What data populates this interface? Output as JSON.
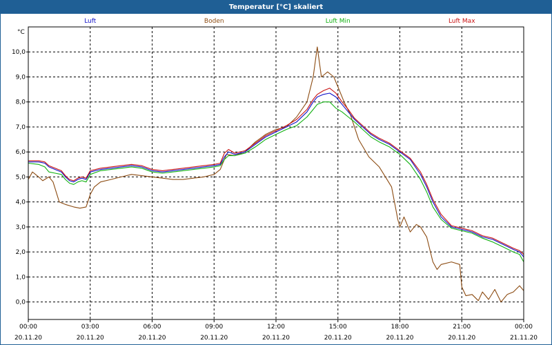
{
  "window": {
    "title": "Temperatur [°C] skaliert"
  },
  "chart_data": {
    "type": "line",
    "title": "Temperatur [°C] skaliert",
    "ylabel": "°C",
    "xlabel": "",
    "ylim": [
      -0.7,
      11.0
    ],
    "xlim": [
      0,
      24
    ],
    "grid": true,
    "legend_placement": "top",
    "y_ticks": [
      "0,0",
      "1,0",
      "2,0",
      "3,0",
      "4,0",
      "5,0",
      "6,0",
      "7,0",
      "8,0",
      "9,0",
      "10,0"
    ],
    "y_tick_values": [
      0,
      1,
      2,
      3,
      4,
      5,
      6,
      7,
      8,
      9,
      10
    ],
    "x_ticks": [
      {
        "time": "00:00",
        "date": "20.11.20",
        "h": 0
      },
      {
        "time": "03:00",
        "date": "20.11.20",
        "h": 3
      },
      {
        "time": "06:00",
        "date": "20.11.20",
        "h": 6
      },
      {
        "time": "09:00",
        "date": "20.11.20",
        "h": 9
      },
      {
        "time": "12:00",
        "date": "20.11.20",
        "h": 12
      },
      {
        "time": "15:00",
        "date": "20.11.20",
        "h": 15
      },
      {
        "time": "18:00",
        "date": "20.11.20",
        "h": 18
      },
      {
        "time": "21:00",
        "date": "20.11.20",
        "h": 21
      },
      {
        "time": "00:00",
        "date": "21.11.20",
        "h": 24
      }
    ],
    "series": [
      {
        "name": "Luft",
        "color": "#1010c8",
        "points": [
          [
            0,
            5.6
          ],
          [
            0.5,
            5.6
          ],
          [
            0.8,
            5.55
          ],
          [
            1,
            5.4
          ],
          [
            1.3,
            5.3
          ],
          [
            1.6,
            5.2
          ],
          [
            1.8,
            5.0
          ],
          [
            2,
            4.85
          ],
          [
            2.2,
            4.8
          ],
          [
            2.4,
            4.9
          ],
          [
            2.6,
            4.95
          ],
          [
            2.8,
            4.9
          ],
          [
            3,
            5.2
          ],
          [
            3.5,
            5.3
          ],
          [
            4,
            5.35
          ],
          [
            4.5,
            5.4
          ],
          [
            5,
            5.45
          ],
          [
            5.5,
            5.4
          ],
          [
            6,
            5.25
          ],
          [
            6.5,
            5.2
          ],
          [
            7,
            5.25
          ],
          [
            7.5,
            5.3
          ],
          [
            8,
            5.35
          ],
          [
            8.5,
            5.4
          ],
          [
            9,
            5.45
          ],
          [
            9.3,
            5.5
          ],
          [
            9.5,
            5.8
          ],
          [
            9.7,
            6.0
          ],
          [
            10,
            5.9
          ],
          [
            10.5,
            6.0
          ],
          [
            11,
            6.3
          ],
          [
            11.5,
            6.6
          ],
          [
            12,
            6.8
          ],
          [
            12.5,
            7.0
          ],
          [
            13,
            7.2
          ],
          [
            13.5,
            7.6
          ],
          [
            13.8,
            8.0
          ],
          [
            14,
            8.2
          ],
          [
            14.3,
            8.3
          ],
          [
            14.6,
            8.35
          ],
          [
            14.9,
            8.2
          ],
          [
            15.2,
            7.9
          ],
          [
            15.5,
            7.6
          ],
          [
            15.8,
            7.3
          ],
          [
            16.2,
            7.0
          ],
          [
            16.6,
            6.7
          ],
          [
            17,
            6.5
          ],
          [
            17.5,
            6.3
          ],
          [
            18,
            6.0
          ],
          [
            18.5,
            5.7
          ],
          [
            19,
            5.1
          ],
          [
            19.3,
            4.6
          ],
          [
            19.6,
            4.0
          ],
          [
            20,
            3.4
          ],
          [
            20.5,
            3.0
          ],
          [
            21,
            2.9
          ],
          [
            21.5,
            2.8
          ],
          [
            22,
            2.6
          ],
          [
            22.5,
            2.5
          ],
          [
            23,
            2.3
          ],
          [
            23.5,
            2.1
          ],
          [
            23.8,
            2.0
          ],
          [
            24,
            1.8
          ]
        ]
      },
      {
        "name": "Boden",
        "color": "#8b4a10",
        "points": [
          [
            0,
            4.9
          ],
          [
            0.2,
            5.2
          ],
          [
            0.5,
            5.0
          ],
          [
            0.7,
            4.85
          ],
          [
            1,
            5.0
          ],
          [
            1.2,
            4.8
          ],
          [
            1.5,
            4.0
          ],
          [
            1.8,
            3.9
          ],
          [
            2.2,
            3.8
          ],
          [
            2.5,
            3.75
          ],
          [
            2.8,
            3.8
          ],
          [
            3,
            4.3
          ],
          [
            3.2,
            4.6
          ],
          [
            3.5,
            4.8
          ],
          [
            4,
            4.9
          ],
          [
            4.5,
            5.0
          ],
          [
            5,
            5.1
          ],
          [
            5.5,
            5.05
          ],
          [
            6,
            5.0
          ],
          [
            6.5,
            4.95
          ],
          [
            7,
            4.9
          ],
          [
            7.5,
            4.9
          ],
          [
            8,
            4.95
          ],
          [
            8.5,
            5.0
          ],
          [
            9,
            5.1
          ],
          [
            9.3,
            5.3
          ],
          [
            9.6,
            5.9
          ],
          [
            10,
            5.85
          ],
          [
            10.5,
            6.0
          ],
          [
            11,
            6.4
          ],
          [
            11.5,
            6.7
          ],
          [
            12,
            6.9
          ],
          [
            12.5,
            7.0
          ],
          [
            13,
            7.4
          ],
          [
            13.5,
            8.0
          ],
          [
            13.8,
            9.0
          ],
          [
            14,
            10.2
          ],
          [
            14.2,
            9.0
          ],
          [
            14.5,
            9.2
          ],
          [
            14.8,
            9.0
          ],
          [
            15,
            8.6
          ],
          [
            15.3,
            8.0
          ],
          [
            15.6,
            7.5
          ],
          [
            16,
            6.5
          ],
          [
            16.5,
            5.8
          ],
          [
            17,
            5.4
          ],
          [
            17.3,
            5.0
          ],
          [
            17.6,
            4.6
          ],
          [
            17.9,
            3.3
          ],
          [
            18,
            3.0
          ],
          [
            18.2,
            3.4
          ],
          [
            18.5,
            2.8
          ],
          [
            18.8,
            3.1
          ],
          [
            19,
            3.0
          ],
          [
            19.3,
            2.6
          ],
          [
            19.6,
            1.6
          ],
          [
            19.8,
            1.3
          ],
          [
            20,
            1.5
          ],
          [
            20.5,
            1.6
          ],
          [
            20.9,
            1.5
          ],
          [
            21,
            0.6
          ],
          [
            21.2,
            0.25
          ],
          [
            21.5,
            0.3
          ],
          [
            21.8,
            0.05
          ],
          [
            22,
            0.4
          ],
          [
            22.3,
            0.1
          ],
          [
            22.6,
            0.5
          ],
          [
            22.9,
            0.0
          ],
          [
            23.2,
            0.3
          ],
          [
            23.5,
            0.4
          ],
          [
            23.8,
            0.65
          ],
          [
            24,
            0.45
          ]
        ]
      },
      {
        "name": "Luft Min",
        "color": "#10b010",
        "points": [
          [
            0,
            5.55
          ],
          [
            0.5,
            5.5
          ],
          [
            0.8,
            5.4
          ],
          [
            1,
            5.2
          ],
          [
            1.3,
            5.15
          ],
          [
            1.6,
            5.1
          ],
          [
            1.8,
            4.9
          ],
          [
            2,
            4.75
          ],
          [
            2.2,
            4.7
          ],
          [
            2.4,
            4.8
          ],
          [
            2.6,
            4.85
          ],
          [
            2.8,
            4.8
          ],
          [
            3,
            5.1
          ],
          [
            3.5,
            5.25
          ],
          [
            4,
            5.3
          ],
          [
            4.5,
            5.35
          ],
          [
            5,
            5.4
          ],
          [
            5.5,
            5.35
          ],
          [
            6,
            5.2
          ],
          [
            6.5,
            5.15
          ],
          [
            7,
            5.2
          ],
          [
            7.5,
            5.25
          ],
          [
            8,
            5.3
          ],
          [
            8.5,
            5.35
          ],
          [
            9,
            5.4
          ],
          [
            9.3,
            5.45
          ],
          [
            9.5,
            5.7
          ],
          [
            9.7,
            5.85
          ],
          [
            10,
            5.85
          ],
          [
            10.5,
            5.95
          ],
          [
            11,
            6.2
          ],
          [
            11.5,
            6.5
          ],
          [
            12,
            6.7
          ],
          [
            12.5,
            6.9
          ],
          [
            13,
            7.05
          ],
          [
            13.5,
            7.4
          ],
          [
            13.8,
            7.7
          ],
          [
            14,
            7.9
          ],
          [
            14.3,
            8.0
          ],
          [
            14.6,
            8.0
          ],
          [
            14.9,
            7.75
          ],
          [
            15.2,
            7.6
          ],
          [
            15.5,
            7.4
          ],
          [
            15.8,
            7.2
          ],
          [
            16.2,
            6.9
          ],
          [
            16.6,
            6.6
          ],
          [
            17,
            6.4
          ],
          [
            17.5,
            6.2
          ],
          [
            18,
            5.9
          ],
          [
            18.5,
            5.5
          ],
          [
            19,
            4.9
          ],
          [
            19.3,
            4.4
          ],
          [
            19.6,
            3.8
          ],
          [
            20,
            3.3
          ],
          [
            20.5,
            2.95
          ],
          [
            21,
            2.85
          ],
          [
            21.5,
            2.75
          ],
          [
            22,
            2.55
          ],
          [
            22.5,
            2.4
          ],
          [
            23,
            2.2
          ],
          [
            23.5,
            2.0
          ],
          [
            23.8,
            1.9
          ],
          [
            24,
            1.6
          ]
        ]
      },
      {
        "name": "Luft Max",
        "color": "#c81010",
        "points": [
          [
            0,
            5.65
          ],
          [
            0.5,
            5.65
          ],
          [
            0.8,
            5.6
          ],
          [
            1,
            5.45
          ],
          [
            1.3,
            5.35
          ],
          [
            1.6,
            5.25
          ],
          [
            1.8,
            5.05
          ],
          [
            2,
            4.9
          ],
          [
            2.2,
            4.85
          ],
          [
            2.4,
            4.95
          ],
          [
            2.6,
            5.0
          ],
          [
            2.8,
            4.95
          ],
          [
            3,
            5.25
          ],
          [
            3.5,
            5.35
          ],
          [
            4,
            5.4
          ],
          [
            4.5,
            5.45
          ],
          [
            5,
            5.5
          ],
          [
            5.5,
            5.45
          ],
          [
            6,
            5.3
          ],
          [
            6.5,
            5.25
          ],
          [
            7,
            5.3
          ],
          [
            7.5,
            5.35
          ],
          [
            8,
            5.4
          ],
          [
            8.5,
            5.45
          ],
          [
            9,
            5.5
          ],
          [
            9.3,
            5.55
          ],
          [
            9.5,
            5.95
          ],
          [
            9.7,
            6.1
          ],
          [
            10,
            5.95
          ],
          [
            10.5,
            6.05
          ],
          [
            11,
            6.35
          ],
          [
            11.5,
            6.65
          ],
          [
            12,
            6.85
          ],
          [
            12.5,
            7.05
          ],
          [
            13,
            7.3
          ],
          [
            13.5,
            7.7
          ],
          [
            13.8,
            8.1
          ],
          [
            14,
            8.3
          ],
          [
            14.3,
            8.45
          ],
          [
            14.6,
            8.55
          ],
          [
            14.9,
            8.35
          ],
          [
            15.2,
            8.0
          ],
          [
            15.5,
            7.7
          ],
          [
            15.8,
            7.35
          ],
          [
            16.2,
            7.05
          ],
          [
            16.6,
            6.75
          ],
          [
            17,
            6.55
          ],
          [
            17.5,
            6.35
          ],
          [
            18,
            6.05
          ],
          [
            18.5,
            5.75
          ],
          [
            19,
            5.2
          ],
          [
            19.3,
            4.7
          ],
          [
            19.6,
            4.1
          ],
          [
            20,
            3.5
          ],
          [
            20.5,
            3.05
          ],
          [
            21,
            2.95
          ],
          [
            21.5,
            2.85
          ],
          [
            22,
            2.65
          ],
          [
            22.5,
            2.55
          ],
          [
            23,
            2.35
          ],
          [
            23.5,
            2.15
          ],
          [
            23.8,
            2.05
          ],
          [
            24,
            1.9
          ]
        ]
      }
    ]
  }
}
